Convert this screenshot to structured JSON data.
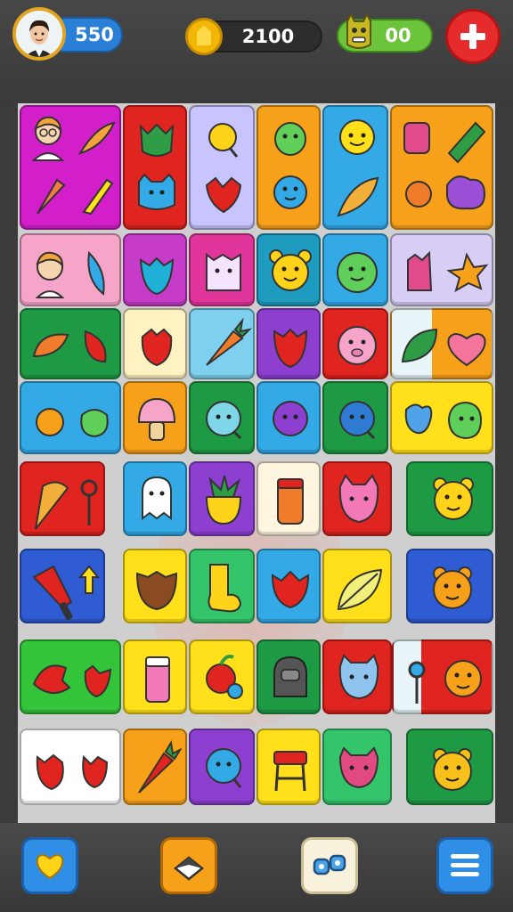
{
  "hud": {
    "score": "550",
    "coins": "2100",
    "lives": "00"
  },
  "colors": {
    "magenta": "#d21fc9",
    "red": "#e0241f",
    "lavender": "#c8c4ff",
    "orange": "#f7a01a",
    "sky": "#33a9e6",
    "pink": "#f6a5c9",
    "purple": "#c63bc8",
    "teal": "#1f9bbf",
    "green": "#1f9a44",
    "cream": "#fff2c2",
    "yellow": "#ffe01a",
    "blue": "#2f5bd3",
    "white": "#ffffff",
    "lime": "#34c46a"
  }
}
